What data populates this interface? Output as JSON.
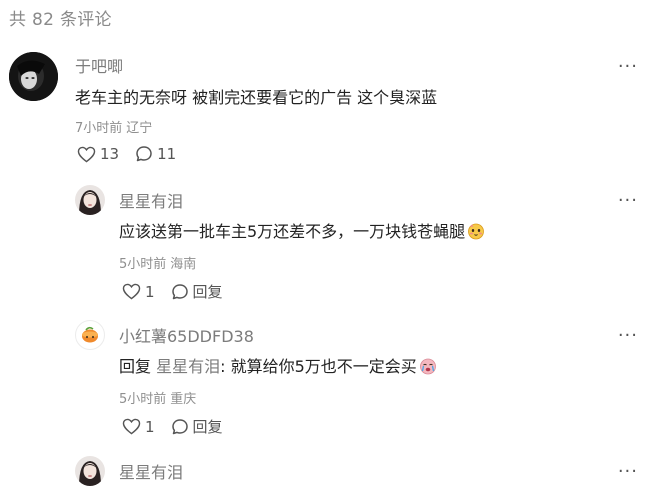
{
  "header": {
    "total_comments": "共 82 条评论"
  },
  "comments": [
    {
      "author": "于吧唧",
      "text": "老车主的无奈呀 被割完还要看它的广告 这个臭深蓝",
      "time": "7小时前",
      "location": "辽宁",
      "likes": "13",
      "replies": "11",
      "more": "···"
    },
    {
      "author": "星星有泪",
      "text": "应该送第一批车主5万还差不多，一万块钱苍蝇腿",
      "time": "5小时前",
      "location": "海南",
      "likes": "1",
      "reply_label": "回复",
      "more": "···"
    },
    {
      "author": "小红薯65DDFD38",
      "reply_prefix": "回复",
      "reply_to": "星星有泪",
      "text": ": 就算给你5万也不一定会买",
      "time": "5小时前",
      "location": "重庆",
      "likes": "1",
      "reply_label": "回复",
      "more": "···"
    },
    {
      "author": "星星有泪",
      "more": "···"
    }
  ]
}
